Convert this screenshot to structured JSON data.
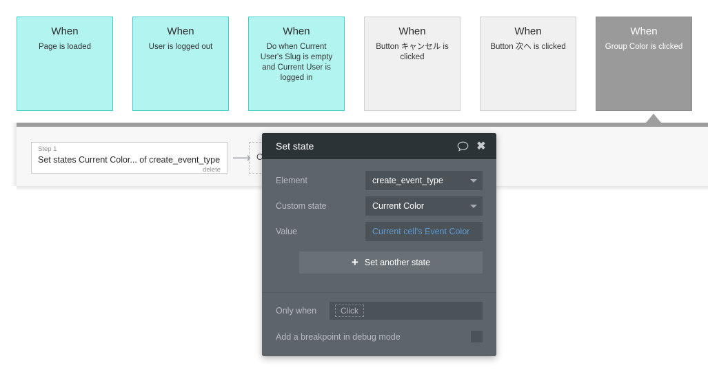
{
  "workflow_cards": [
    {
      "when": "When",
      "desc": "Page is loaded",
      "state": "cyan"
    },
    {
      "when": "When",
      "desc": "User is logged out",
      "state": "cyan"
    },
    {
      "when": "When",
      "desc": "Do when Current User's Slug is empty and Current User is logged in",
      "state": "cyan"
    },
    {
      "when": "When",
      "desc": "Button キャンセル is clicked",
      "state": "grey"
    },
    {
      "when": "When",
      "desc": "Button 次へ is clicked",
      "state": "grey"
    },
    {
      "when": "When",
      "desc": "Group Color is clicked",
      "state": "selected"
    }
  ],
  "action_panel": {
    "step": {
      "label": "Step 1",
      "title": "Set states Current Color... of create_event_type",
      "delete": "delete"
    },
    "arrow_icon": "arrow-right-icon",
    "add_action": "Click here to add an action..."
  },
  "dialog": {
    "title": "Set state",
    "comment_icon": "comment-bubble-icon",
    "close_icon": "close-icon",
    "fields": [
      {
        "label": "Element",
        "value": "create_event_type",
        "type": "dropdown"
      },
      {
        "label": "Custom state",
        "value": "Current Color",
        "type": "dropdown"
      },
      {
        "label": "Value",
        "value": "Current cell's Event Color",
        "type": "expression"
      }
    ],
    "add_state_button": "Set another state",
    "plus_icon": "plus-icon",
    "only_when": {
      "label": "Only when",
      "placeholder": "Click"
    },
    "breakpoint": {
      "label": "Add a breakpoint in debug mode",
      "checked": false
    }
  },
  "colors": {
    "card_cyan_bg": "#b2f5f0",
    "card_cyan_border": "#44ccc6",
    "card_grey_bg": "#f0f0f0",
    "card_selected_bg": "#9a9a9a",
    "dialog_bg": "#5e656a",
    "dialog_header_bg": "#2b3337",
    "expression_blue": "#5b9bd5",
    "panel_bg": "#f7f7f7"
  }
}
